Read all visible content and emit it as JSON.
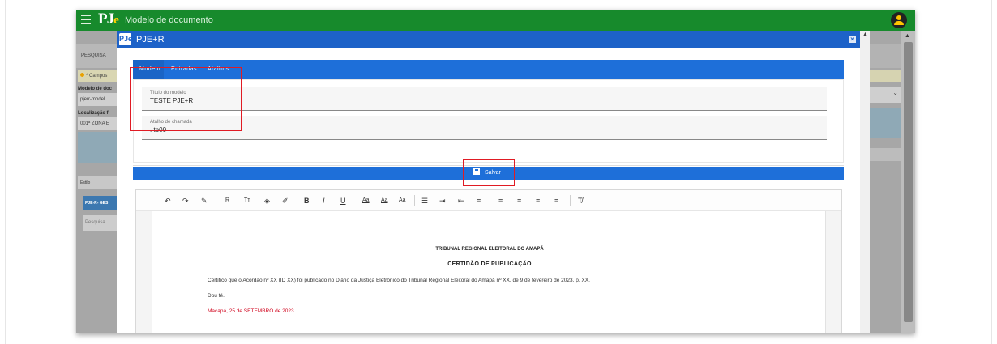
{
  "app": {
    "page_title": "Modelo de documento",
    "logo_text": "PJ",
    "logo_accent": "e"
  },
  "background": {
    "tab_label": "PESQUISA",
    "alert_text": "* Campos",
    "field1_label": "Modelo de doc",
    "field1_value": "pjerr-model",
    "field2_label": "Localização fi",
    "field2_value": "001ª ZONA E",
    "toolbar_label": "Estilo",
    "chip_label": "PJE-R- GES",
    "search_placeholder": "Pesquisa",
    "select_arrow": "⌄"
  },
  "modal": {
    "logo_text": "PJe",
    "title": "PJE+R",
    "close_label": "×",
    "tabs": [
      {
        "label": "Modelo"
      },
      {
        "label": "Entradas"
      },
      {
        "label": "Atalhos"
      }
    ],
    "fields": {
      "title_label": "Título do modelo",
      "title_value": "TESTE PJE+R",
      "shortcut_label": "Atalho de chamada",
      "shortcut_value": ". tp00"
    },
    "save_label": "Salvar"
  },
  "toolbar": {
    "buttons": [
      "↶",
      "↷",
      "✎",
      "R̲",
      "Tт",
      "◈",
      "✐",
      "B",
      "I",
      "U",
      "Aa",
      "Aa",
      "Aa",
      "☰",
      "⇥",
      "⇤",
      "≡",
      "≡",
      "≡",
      "≡",
      "≡",
      "T̸"
    ]
  },
  "document": {
    "heading": "TRIBUNAL REGIONAL ELEITORAL DO AMAPÁ",
    "title": "CERTIDÃO DE PUBLICAÇÃO",
    "paragraph1": "Certifico que o Acórdão nº XX (ID XX) foi publicado no Diário da Justiça Eletrônico do Tribunal Regional Eleitoral do Amapá nº XX, de 9 de fevereiro de 2023, p. XX.",
    "paragraph2": "Dou fé.",
    "paragraph3": "Macapá, 25 de SETEMBRO de 2023."
  },
  "colors": {
    "topbar": "#178a2c",
    "modal_header": "#1d62c8",
    "tabbar": "#1e6fd9",
    "highlight": "#e01b24",
    "date_text": "#d0021b"
  }
}
